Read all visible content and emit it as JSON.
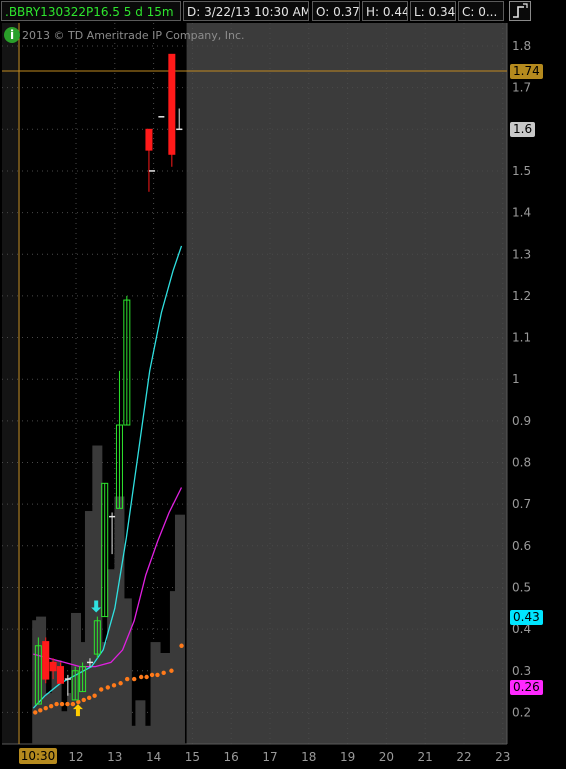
{
  "header": {
    "symbol": ".BBRY130322P16.5 5 d 15m",
    "date": "D: 3/22/13 10:30 AM",
    "open": "O: 0.37",
    "high": "H: 0.44",
    "low": "L: 0.34",
    "close": "C: 0...",
    "style_icon": "chart-style-icon"
  },
  "copyright": {
    "icon": "i",
    "text": "2013 © TD Ameritrade IP Company, Inc."
  },
  "time_marker": "10:30",
  "price_badges": [
    {
      "label": "1.74",
      "value": 1.74,
      "bg": "#b58a1e",
      "fg": "#000000"
    },
    {
      "label": "1.6",
      "value": 1.6,
      "bg": "#c8c8c8",
      "fg": "#000000"
    },
    {
      "label": "0.43",
      "value": 0.43,
      "bg": "#00e5ff",
      "fg": "#000000"
    },
    {
      "label": "0.26",
      "value": 0.26,
      "bg": "#ff28ff",
      "fg": "#000000"
    }
  ],
  "colors": {
    "up": "#2ee62e",
    "down": "#ff1a1a",
    "neutral": "#e6e6e6",
    "volume": "#3a3a3a",
    "ma_fast": "#2fe0e0",
    "ma_slow": "#e020e0",
    "dots": "#ff7a1a",
    "hline": "#c08a20",
    "future_area": "#3b3b3b"
  },
  "chart_data": {
    "type": "candlestick",
    "ylim": [
      0.16,
      1.86
    ],
    "y_ticks": [
      0.2,
      0.3,
      0.4,
      0.5,
      0.6,
      0.7,
      0.8,
      0.9,
      1,
      1.1,
      1.2,
      1.3,
      1.4,
      1.5,
      1.6,
      1.7,
      1.8
    ],
    "y_tick_labels": [
      "0.2",
      "0.3",
      "0.4",
      "0.5",
      "0.6",
      "0.7",
      "0.8",
      "0.9",
      "1",
      "1.1",
      "1.2",
      "1.3",
      "1.4",
      "1.5",
      "1.6",
      "1.7",
      "1.8"
    ],
    "x_ticks": [
      {
        "label": "12",
        "day": 12
      },
      {
        "label": "13",
        "day": 13
      },
      {
        "label": "14",
        "day": 14
      },
      {
        "label": "15",
        "day": 15
      },
      {
        "label": "16",
        "day": 16
      },
      {
        "label": "17",
        "day": 17
      },
      {
        "label": "18",
        "day": 18
      },
      {
        "label": "19",
        "day": 19
      },
      {
        "label": "20",
        "day": 20
      },
      {
        "label": "21",
        "day": 21
      },
      {
        "label": "22",
        "day": 22
      },
      {
        "label": "23",
        "day": 23
      }
    ],
    "reference_line": 1.74,
    "candles": [
      {
        "day": 11.03,
        "o": 0.22,
        "h": 0.38,
        "l": 0.22,
        "c": 0.36
      },
      {
        "day": 11.22,
        "o": 0.37,
        "h": 0.38,
        "l": 0.27,
        "c": 0.28
      },
      {
        "day": 11.41,
        "o": 0.32,
        "h": 0.33,
        "l": 0.28,
        "c": 0.3
      },
      {
        "day": 11.6,
        "o": 0.31,
        "h": 0.32,
        "l": 0.27,
        "c": 0.27
      },
      {
        "day": 11.79,
        "o": 0.28,
        "h": 0.29,
        "l": 0.24,
        "c": 0.28
      },
      {
        "day": 11.98,
        "o": 0.23,
        "h": 0.31,
        "l": 0.23,
        "c": 0.3
      },
      {
        "day": 12.17,
        "o": 0.25,
        "h": 0.32,
        "l": 0.25,
        "c": 0.31
      },
      {
        "day": 12.36,
        "o": 0.32,
        "h": 0.33,
        "l": 0.31,
        "c": 0.32
      },
      {
        "day": 12.55,
        "o": 0.34,
        "h": 0.43,
        "l": 0.33,
        "c": 0.42
      },
      {
        "day": 12.74,
        "o": 0.43,
        "h": 0.75,
        "l": 0.43,
        "c": 0.75
      },
      {
        "day": 12.93,
        "o": 0.67,
        "h": 0.68,
        "l": 0.58,
        "c": 0.67
      },
      {
        "day": 13.12,
        "o": 0.69,
        "h": 1.02,
        "l": 0.69,
        "c": 0.89
      },
      {
        "day": 13.31,
        "o": 0.89,
        "h": 1.2,
        "l": 0.89,
        "c": 1.19
      },
      {
        "day": 13.88,
        "o": 1.6,
        "h": 1.6,
        "l": 1.45,
        "c": 1.55
      },
      {
        "day": 13.96,
        "o": 1.5,
        "h": 1.5,
        "l": 1.5,
        "c": 1.5
      },
      {
        "day": 14.2,
        "o": 1.63,
        "h": 1.63,
        "l": 1.63,
        "c": 1.63
      },
      {
        "day": 14.47,
        "o": 1.78,
        "h": 1.78,
        "l": 1.51,
        "c": 1.54
      },
      {
        "day": 14.66,
        "o": 1.6,
        "h": 1.65,
        "l": 1.6,
        "c": 1.6
      }
    ],
    "volume_max": 1,
    "volume": [
      {
        "day": 11.0,
        "v": 0.34
      },
      {
        "day": 11.1,
        "v": 0.35
      },
      {
        "day": 11.22,
        "v": 0.12
      },
      {
        "day": 11.33,
        "v": 0.14
      },
      {
        "day": 11.5,
        "v": 0.23
      },
      {
        "day": 11.7,
        "v": 0.09
      },
      {
        "day": 11.9,
        "v": 0.14
      },
      {
        "day": 12.0,
        "v": 0.36
      },
      {
        "day": 12.2,
        "v": 0.28
      },
      {
        "day": 12.36,
        "v": 0.64
      },
      {
        "day": 12.55,
        "v": 0.82
      },
      {
        "day": 12.74,
        "v": 0.28
      },
      {
        "day": 12.93,
        "v": 0.48
      },
      {
        "day": 13.12,
        "v": 0.68
      },
      {
        "day": 13.31,
        "v": 0.4
      },
      {
        "day": 13.5,
        "v": 0.05
      },
      {
        "day": 13.66,
        "v": 0.12
      },
      {
        "day": 13.85,
        "v": 0.05
      },
      {
        "day": 14.05,
        "v": 0.28
      },
      {
        "day": 14.3,
        "v": 0.25
      },
      {
        "day": 14.55,
        "v": 0.42
      },
      {
        "day": 14.68,
        "v": 0.63
      }
    ],
    "ma_fast": [
      {
        "day": 10.9,
        "y": 0.21
      },
      {
        "day": 11.2,
        "y": 0.24
      },
      {
        "day": 11.6,
        "y": 0.27
      },
      {
        "day": 12.0,
        "y": 0.29
      },
      {
        "day": 12.4,
        "y": 0.31
      },
      {
        "day": 12.7,
        "y": 0.35
      },
      {
        "day": 13.0,
        "y": 0.45
      },
      {
        "day": 13.3,
        "y": 0.62
      },
      {
        "day": 13.6,
        "y": 0.82
      },
      {
        "day": 13.9,
        "y": 1.02
      },
      {
        "day": 14.2,
        "y": 1.16
      },
      {
        "day": 14.5,
        "y": 1.26
      },
      {
        "day": 14.72,
        "y": 1.32
      }
    ],
    "ma_slow": [
      {
        "day": 10.9,
        "y": 0.34
      },
      {
        "day": 11.3,
        "y": 0.33
      },
      {
        "day": 11.7,
        "y": 0.32
      },
      {
        "day": 12.1,
        "y": 0.31
      },
      {
        "day": 12.5,
        "y": 0.31
      },
      {
        "day": 12.9,
        "y": 0.32
      },
      {
        "day": 13.2,
        "y": 0.35
      },
      {
        "day": 13.5,
        "y": 0.42
      },
      {
        "day": 13.8,
        "y": 0.53
      },
      {
        "day": 14.1,
        "y": 0.61
      },
      {
        "day": 14.4,
        "y": 0.68
      },
      {
        "day": 14.72,
        "y": 0.74
      }
    ],
    "dots": [
      {
        "day": 10.95,
        "y": 0.2
      },
      {
        "day": 11.08,
        "y": 0.205
      },
      {
        "day": 11.22,
        "y": 0.21
      },
      {
        "day": 11.36,
        "y": 0.215
      },
      {
        "day": 11.5,
        "y": 0.22
      },
      {
        "day": 11.64,
        "y": 0.22
      },
      {
        "day": 11.78,
        "y": 0.22
      },
      {
        "day": 11.92,
        "y": 0.22
      },
      {
        "day": 12.06,
        "y": 0.225
      },
      {
        "day": 12.2,
        "y": 0.23
      },
      {
        "day": 12.34,
        "y": 0.235
      },
      {
        "day": 12.48,
        "y": 0.24
      },
      {
        "day": 12.65,
        "y": 0.255
      },
      {
        "day": 12.82,
        "y": 0.26
      },
      {
        "day": 12.98,
        "y": 0.265
      },
      {
        "day": 13.15,
        "y": 0.27
      },
      {
        "day": 13.32,
        "y": 0.28
      },
      {
        "day": 13.5,
        "y": 0.28
      },
      {
        "day": 13.68,
        "y": 0.285
      },
      {
        "day": 13.82,
        "y": 0.285
      },
      {
        "day": 13.96,
        "y": 0.29
      },
      {
        "day": 14.1,
        "y": 0.29
      },
      {
        "day": 14.26,
        "y": 0.295
      },
      {
        "day": 14.46,
        "y": 0.3
      },
      {
        "day": 14.72,
        "y": 0.36
      }
    ],
    "signals": [
      {
        "day": 12.52,
        "y": 0.44,
        "type": "down",
        "color": "#2fe0e0"
      },
      {
        "day": 12.05,
        "y": 0.22,
        "type": "up",
        "color": "#ffcc00"
      }
    ]
  }
}
